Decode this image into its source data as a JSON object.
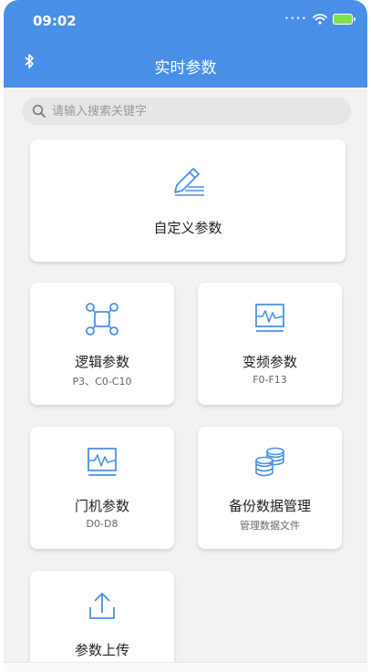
{
  "status_bar": {
    "time": "09:02"
  },
  "header": {
    "title": "实时参数"
  },
  "search": {
    "placeholder": "请输入搜索关键字"
  },
  "cards": {
    "custom": {
      "label": "自定义参数"
    },
    "logic": {
      "label": "逻辑参数",
      "sub": "P3、C0-C10"
    },
    "frequency": {
      "label": "变频参数",
      "sub": "F0-F13"
    },
    "door": {
      "label": "门机参数",
      "sub": "D0-D8"
    },
    "backup": {
      "label": "备份数据管理",
      "sub": "管理数据文件"
    },
    "upload": {
      "label": "参数上传"
    }
  },
  "colors": {
    "accent": "#4a8fe7",
    "icon": "#4a8fe7",
    "background": "#f2f2f2"
  }
}
